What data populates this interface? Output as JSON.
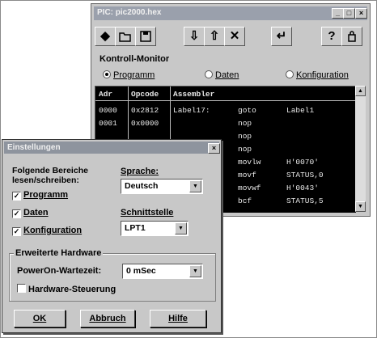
{
  "main_window": {
    "title": "PIC: pic2000.hex",
    "toolbar_icons": [
      "diamond-icon",
      "open-folder-icon",
      "save-disk-icon",
      "download-arrow-icon",
      "upload-arrow-icon",
      "erase-x-icon",
      "run-icon",
      "help-icon",
      "info-icon"
    ],
    "group_label": "Kontroll-Monitor",
    "radios": [
      {
        "label": "Programm",
        "checked": true
      },
      {
        "label": "Daten",
        "checked": false
      },
      {
        "label": "Konfiguration",
        "checked": false
      }
    ],
    "monitor": {
      "headers": [
        "Adr",
        "Opcode",
        "Assembler"
      ],
      "rows": [
        {
          "adr": "0000",
          "opcode": "0x2812",
          "label": "Label17:",
          "mnemonic": "goto",
          "operand": "Label1"
        },
        {
          "adr": "0001",
          "opcode": "0x0000",
          "label": "",
          "mnemonic": "nop",
          "operand": ""
        },
        {
          "adr": "",
          "opcode": "",
          "label": "",
          "mnemonic": "nop",
          "operand": ""
        },
        {
          "adr": "",
          "opcode": "",
          "label": "",
          "mnemonic": "nop",
          "operand": ""
        },
        {
          "adr": "",
          "opcode": "",
          "label": "",
          "mnemonic": "movlw",
          "operand": "H'0070'"
        },
        {
          "adr": "",
          "opcode": "",
          "label": "",
          "mnemonic": "movf",
          "operand": "STATUS,0"
        },
        {
          "adr": "",
          "opcode": "",
          "label": "",
          "mnemonic": "movwf",
          "operand": "H'0043'"
        },
        {
          "adr": "",
          "opcode": "",
          "label": "",
          "mnemonic": "bcf",
          "operand": "STATUS,5"
        }
      ]
    }
  },
  "dialog": {
    "title": "Einstellungen",
    "close_label": "×",
    "bereiche_label_1": "Folgende Bereiche",
    "bereiche_label_2": "lesen/schreiben:",
    "checkboxes": [
      {
        "label": "Programm",
        "checked": true
      },
      {
        "label": "Daten",
        "checked": true
      },
      {
        "label": "Konfiguration",
        "checked": true
      }
    ],
    "sprache_label": "Sprache:",
    "sprache_value": "Deutsch",
    "schnittstelle_label": "Schnittstelle",
    "schnittstelle_value": "LPT1",
    "erweiterte_label": "Erweiterte Hardware",
    "poweron_label": "PowerOn-Wartezeit:",
    "poweron_value": "0 mSec",
    "hardware_steuerung_label": "Hardware-Steuerung",
    "hardware_steuerung_checked": false,
    "buttons": {
      "ok": "OK",
      "abbruch": "Abbruch",
      "hilfe": "Hilfe"
    }
  }
}
